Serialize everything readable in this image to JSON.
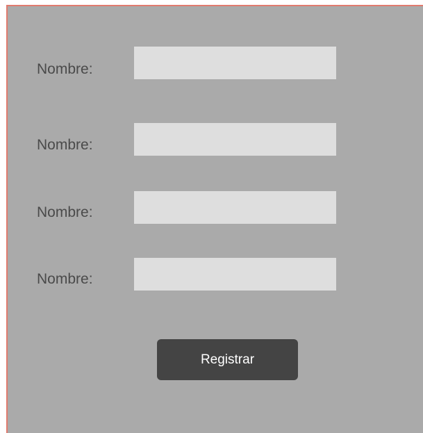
{
  "form": {
    "rows": [
      {
        "label": "Nombre:",
        "value": "",
        "placeholder": ""
      },
      {
        "label": "Nombre:",
        "value": "",
        "placeholder": ""
      },
      {
        "label": "Nombre:",
        "value": "",
        "placeholder": ""
      },
      {
        "label": "Nombre:",
        "value": "",
        "placeholder": ""
      }
    ],
    "submit_label": "Registrar"
  },
  "colors": {
    "panel_background": "#aaaaaa",
    "panel_border": "#e07a6e",
    "field_background": "#dedede",
    "button_background": "#444444",
    "button_text": "#ffffff",
    "label_text": "#4a4a4a"
  }
}
